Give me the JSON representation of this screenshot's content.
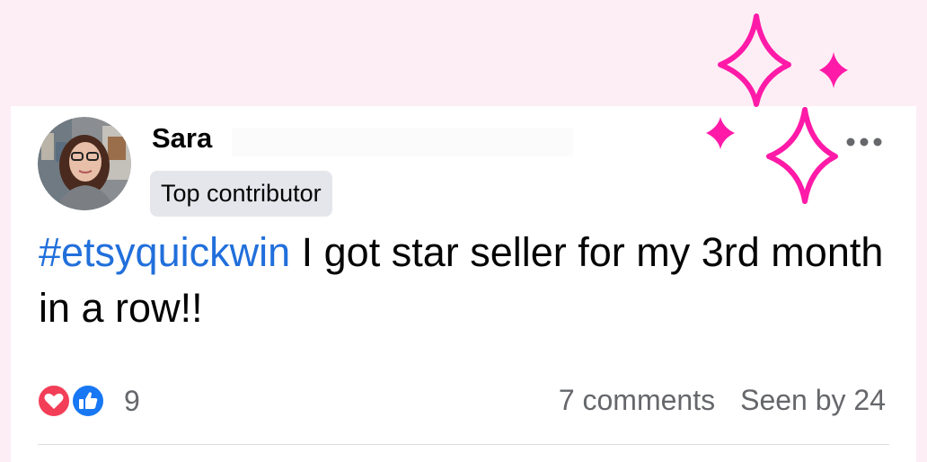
{
  "post": {
    "author": {
      "name": "Sara",
      "badge": "Top contributor",
      "avatar_icon": "profile-photo"
    },
    "hashtag": "#etsyquickwin",
    "body": " I got star seller for my 3rd month in a row!!",
    "reactions": {
      "types": [
        "love-icon",
        "like-icon"
      ],
      "count": "9"
    },
    "comments_label": "7 comments",
    "seen_by_label": "Seen by 24"
  },
  "colors": {
    "background": "#fdeef6",
    "hashtag": "#216fdb",
    "sparkle": "#ff1aa8",
    "love": "#f33e58",
    "like": "#1877f2",
    "muted_text": "#65676b",
    "badge_bg": "#e4e6eb"
  }
}
